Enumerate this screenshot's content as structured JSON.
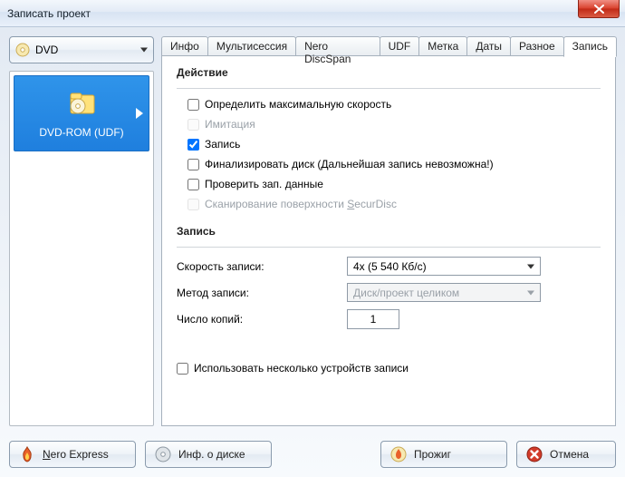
{
  "window": {
    "title": "Записать проект"
  },
  "drive_selector": {
    "label": "DVD"
  },
  "sidebar": {
    "tile_label": "DVD-ROM (UDF)"
  },
  "tabs": {
    "items": [
      {
        "label": "Инфо"
      },
      {
        "label": "Мультисессия"
      },
      {
        "label": "Nero DiscSpan"
      },
      {
        "label": "UDF"
      },
      {
        "label": "Метка"
      },
      {
        "label": "Даты"
      },
      {
        "label": "Разное"
      },
      {
        "label": "Запись"
      }
    ],
    "active_index": 7
  },
  "sections": {
    "action": {
      "heading": "Действие",
      "options": {
        "determine_max_speed": {
          "label": "Определить максимальную скорость",
          "checked": false,
          "enabled": true
        },
        "simulate": {
          "label": "Имитация",
          "checked": false,
          "enabled": false
        },
        "write": {
          "label": "Запись",
          "checked": true,
          "enabled": true
        },
        "finalize": {
          "label": "Финализировать диск (Дальнейшая запись невозможна!)",
          "checked": false,
          "enabled": true
        },
        "verify": {
          "label": "Проверить зап. данные",
          "checked": false,
          "enabled": true
        },
        "scan_prefix": {
          "label_prefix": "Сканирование поверхности ",
          "label_hot": "S",
          "label_suffix": "ecurDisc",
          "checked": false,
          "enabled": false
        }
      }
    },
    "burn": {
      "heading": "Запись",
      "speed": {
        "label": "Скорость записи:",
        "value": "4x (5 540 Кб/с)"
      },
      "method": {
        "label": "Метод записи:",
        "value": "Диск/проект целиком",
        "enabled": false
      },
      "copies": {
        "label": "Число копий:",
        "value": "1"
      },
      "multi_recorders": {
        "label": "Использовать несколько устройств записи",
        "checked": false
      }
    }
  },
  "buttons": {
    "nero_express": {
      "prefix": "N",
      "rest": "ero Express"
    },
    "disc_info": {
      "label": "Инф. о диске"
    },
    "burn": {
      "label": "Прожиг"
    },
    "cancel": {
      "label": "Отмена"
    }
  }
}
